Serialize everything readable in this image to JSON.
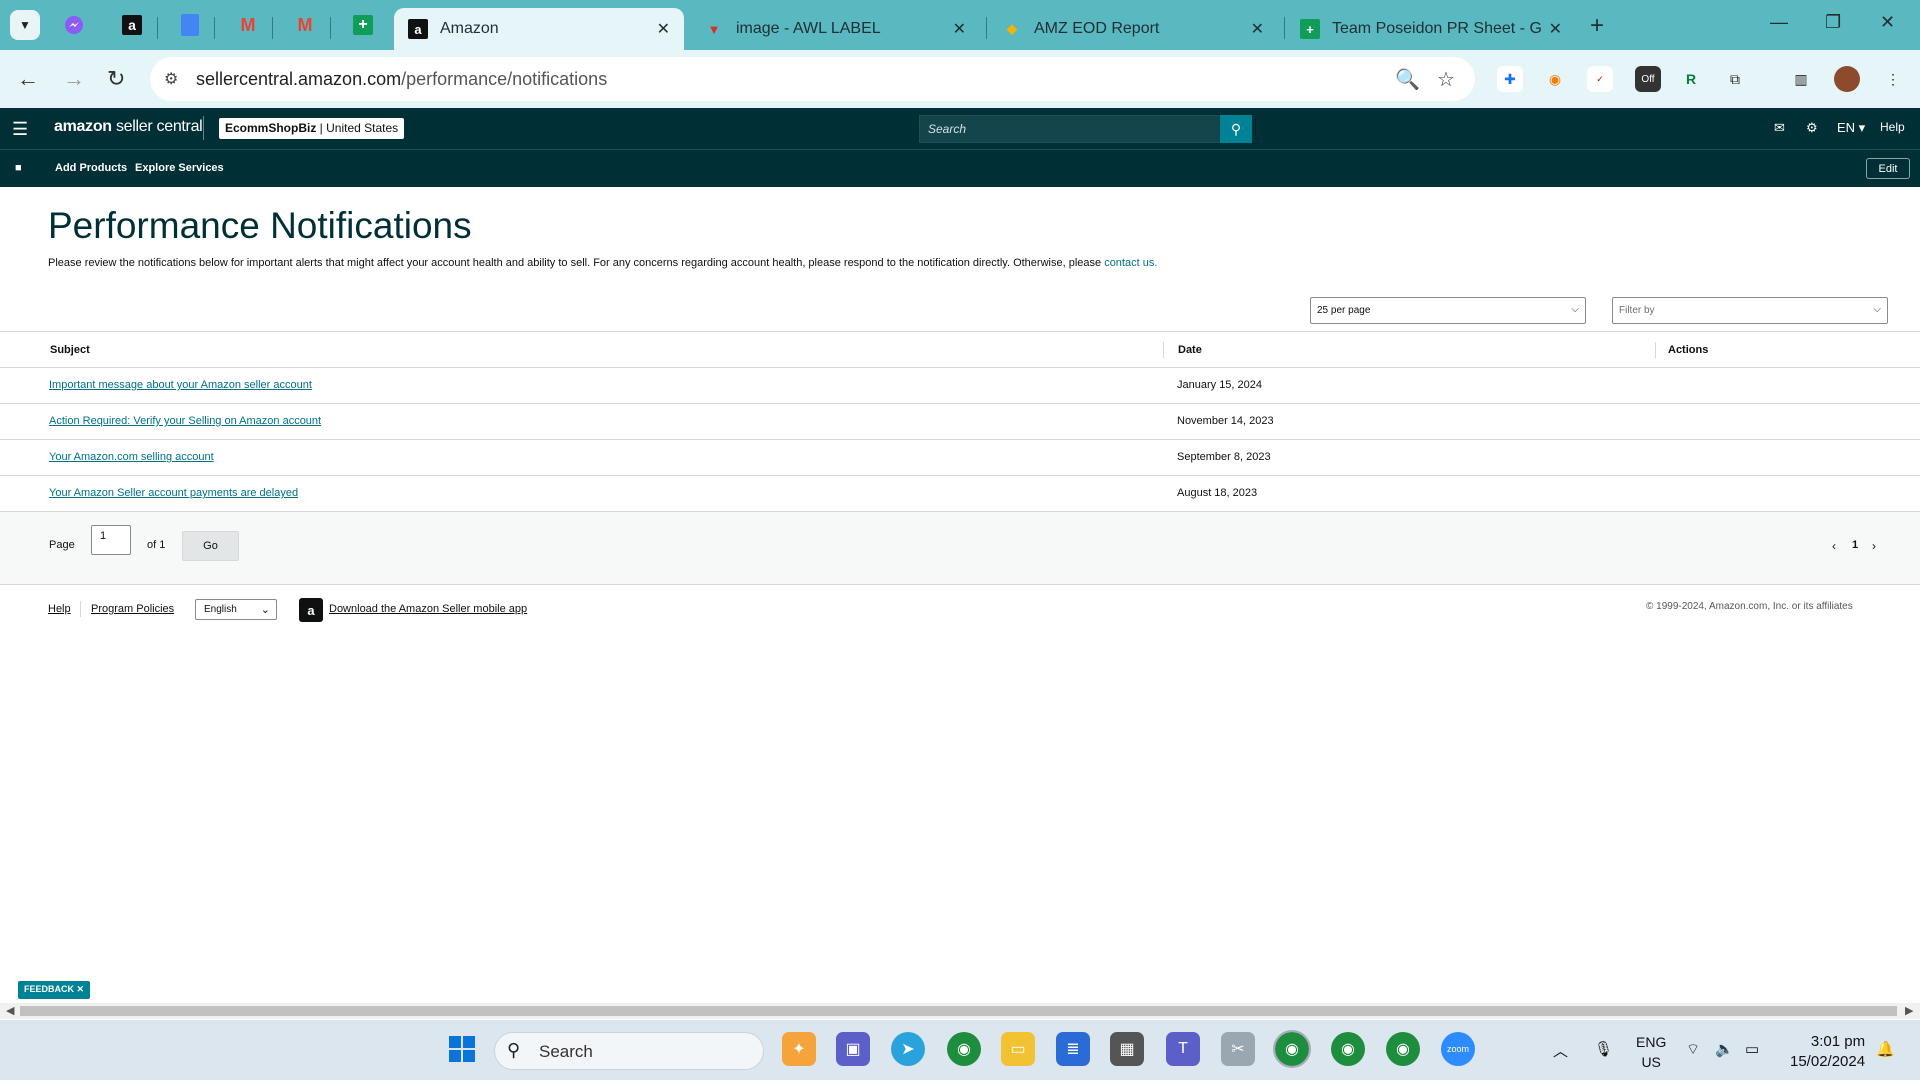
{
  "browser": {
    "tabs": [
      {
        "label": "Amazon",
        "active": true
      },
      {
        "label": "image - AWL LABEL",
        "active": false
      },
      {
        "label": "AMZ EOD Report",
        "active": false
      },
      {
        "label": "Team Poseidon PR Sheet - Goo",
        "active": false
      }
    ],
    "url_host": "sellercentral.amazon.com",
    "url_path": "/performance/notifications"
  },
  "header": {
    "brand": "amazon",
    "brand_suffix": "seller central",
    "store_name": "EcommShopBiz",
    "store_region": "United States",
    "search_placeholder": "Search",
    "language": "EN",
    "help": "Help"
  },
  "nav": {
    "add_products": "Add Products",
    "explore_services": "Explore Services",
    "edit": "Edit"
  },
  "main": {
    "title": "Performance Notifications",
    "description": "Please review the notifications below for important alerts that might affect your account health and ability to sell. For any concerns regarding account health, please respond to the notification directly. Otherwise, please",
    "contact_link": "contact us.",
    "per_page": "25 per page",
    "filter_placeholder": "Filter by",
    "columns": {
      "subject": "Subject",
      "date": "Date",
      "actions": "Actions"
    },
    "rows": [
      {
        "subject": "Important message about your Amazon seller account",
        "date": "January 15, 2024"
      },
      {
        "subject": "Action Required: Verify your Selling on Amazon account",
        "date": "November 14, 2023"
      },
      {
        "subject": "Your Amazon.com selling account",
        "date": "September 8, 2023"
      },
      {
        "subject": "Your Amazon Seller account payments are delayed",
        "date": "August 18, 2023"
      }
    ],
    "pagination": {
      "page_label": "Page",
      "page_value": "1",
      "of_label": "of 1",
      "go": "Go",
      "current": "1"
    }
  },
  "footer": {
    "help": "Help",
    "program_policies": "Program Policies",
    "language": "English",
    "download_app": "Download the Amazon Seller mobile app",
    "copyright": "© 1999-2024, Amazon.com, Inc. or its affiliates"
  },
  "feedback": "FEEDBACK ✕",
  "taskbar": {
    "search": "Search",
    "lang_top": "ENG",
    "lang_bottom": "US",
    "time": "3:01 pm",
    "date": "15/02/2024"
  },
  "colors": {
    "amazon_header": "#002f36",
    "link": "#007185",
    "accent": "#008296",
    "chrome_tabstrip": "#5ab8c1"
  }
}
